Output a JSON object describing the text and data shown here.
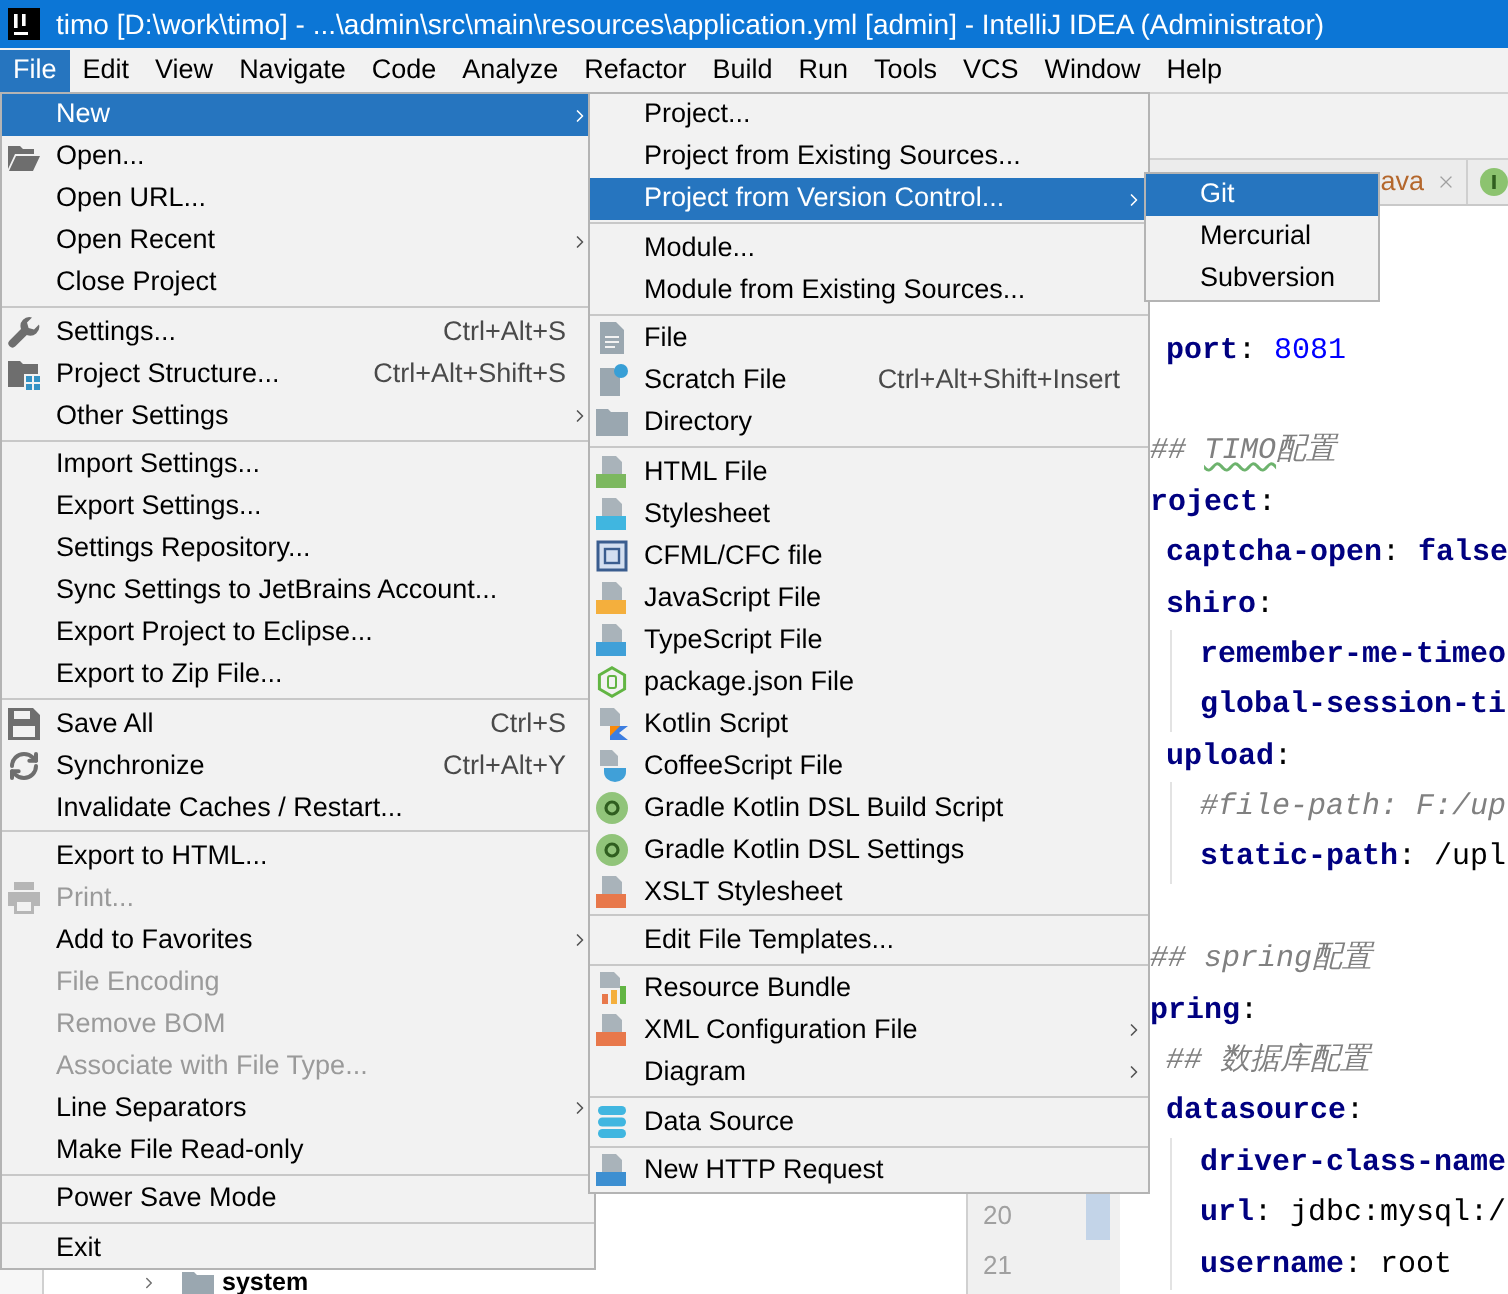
{
  "window": {
    "title": "timo [D:\\work\\timo] - ...\\admin\\src\\main\\resources\\application.yml [admin] - IntelliJ IDEA (Administrator)"
  },
  "menu_bar": [
    {
      "label": "File",
      "selected": true
    },
    {
      "label": "Edit",
      "selected": false
    },
    {
      "label": "View",
      "selected": false
    },
    {
      "label": "Navigate",
      "selected": false
    },
    {
      "label": "Code",
      "selected": false
    },
    {
      "label": "Analyze",
      "selected": false
    },
    {
      "label": "Refactor",
      "selected": false
    },
    {
      "label": "Build",
      "selected": false
    },
    {
      "label": "Run",
      "selected": false
    },
    {
      "label": "Tools",
      "selected": false
    },
    {
      "label": "VCS",
      "selected": false
    },
    {
      "label": "Window",
      "selected": false
    },
    {
      "label": "Help",
      "selected": false
    }
  ],
  "file_menu": {
    "items": [
      {
        "kind": "item",
        "label": "New",
        "selected": true,
        "disabled": false,
        "submenu": true
      },
      {
        "kind": "item",
        "label": "Open...",
        "selected": false,
        "disabled": false,
        "submenu": false
      },
      {
        "kind": "item",
        "label": "Open URL...",
        "selected": false,
        "disabled": false,
        "submenu": false
      },
      {
        "kind": "item",
        "label": "Open Recent",
        "selected": false,
        "disabled": false,
        "submenu": true
      },
      {
        "kind": "item",
        "label": "Close Project",
        "selected": false,
        "disabled": false,
        "submenu": false
      },
      {
        "kind": "separator"
      },
      {
        "kind": "item",
        "label": "Settings...",
        "shortcut": "Ctrl+Alt+S",
        "selected": false,
        "disabled": false,
        "submenu": false
      },
      {
        "kind": "item",
        "label": "Project Structure...",
        "shortcut": "Ctrl+Alt+Shift+S",
        "selected": false,
        "disabled": false,
        "submenu": false
      },
      {
        "kind": "item",
        "label": "Other Settings",
        "selected": false,
        "disabled": false,
        "submenu": true
      },
      {
        "kind": "separator"
      },
      {
        "kind": "item",
        "label": "Import Settings...",
        "selected": false,
        "disabled": false,
        "submenu": false
      },
      {
        "kind": "item",
        "label": "Export Settings...",
        "selected": false,
        "disabled": false,
        "submenu": false
      },
      {
        "kind": "item",
        "label": "Settings Repository...",
        "selected": false,
        "disabled": false,
        "submenu": false
      },
      {
        "kind": "item",
        "label": "Sync Settings to JetBrains Account...",
        "selected": false,
        "disabled": false,
        "submenu": false
      },
      {
        "kind": "item",
        "label": "Export Project to Eclipse...",
        "selected": false,
        "disabled": false,
        "submenu": false
      },
      {
        "kind": "item",
        "label": "Export to Zip File...",
        "selected": false,
        "disabled": false,
        "submenu": false
      },
      {
        "kind": "separator"
      },
      {
        "kind": "item",
        "label": "Save All",
        "shortcut": "Ctrl+S",
        "selected": false,
        "disabled": false,
        "submenu": false
      },
      {
        "kind": "item",
        "label": "Synchronize",
        "shortcut": "Ctrl+Alt+Y",
        "selected": false,
        "disabled": false,
        "submenu": false
      },
      {
        "kind": "item",
        "label": "Invalidate Caches / Restart...",
        "selected": false,
        "disabled": false,
        "submenu": false
      },
      {
        "kind": "separator"
      },
      {
        "kind": "item",
        "label": "Export to HTML...",
        "selected": false,
        "disabled": false,
        "submenu": false
      },
      {
        "kind": "item",
        "label": "Print...",
        "selected": false,
        "disabled": true,
        "submenu": false
      },
      {
        "kind": "item",
        "label": "Add to Favorites",
        "selected": false,
        "disabled": false,
        "submenu": true
      },
      {
        "kind": "item",
        "label": "File Encoding",
        "selected": false,
        "disabled": true,
        "submenu": false
      },
      {
        "kind": "item",
        "label": "Remove BOM",
        "selected": false,
        "disabled": true,
        "submenu": false
      },
      {
        "kind": "item",
        "label": "Associate with File Type...",
        "selected": false,
        "disabled": true,
        "submenu": false
      },
      {
        "kind": "item",
        "label": "Line Separators",
        "selected": false,
        "disabled": false,
        "submenu": true
      },
      {
        "kind": "item",
        "label": "Make File Read-only",
        "selected": false,
        "disabled": false,
        "submenu": false
      },
      {
        "kind": "separator"
      },
      {
        "kind": "item",
        "label": "Power Save Mode",
        "selected": false,
        "disabled": false,
        "submenu": false
      },
      {
        "kind": "separator"
      },
      {
        "kind": "item",
        "label": "Exit",
        "selected": false,
        "disabled": false,
        "submenu": false
      }
    ]
  },
  "new_submenu": {
    "items": [
      {
        "kind": "item",
        "label": "Project...",
        "selected": false,
        "submenu": false
      },
      {
        "kind": "item",
        "label": "Project from Existing Sources...",
        "selected": false,
        "submenu": false
      },
      {
        "kind": "item",
        "label": "Project from Version Control...",
        "selected": true,
        "submenu": true
      },
      {
        "kind": "separator"
      },
      {
        "kind": "item",
        "label": "Module...",
        "selected": false,
        "submenu": false
      },
      {
        "kind": "item",
        "label": "Module from Existing Sources...",
        "selected": false,
        "submenu": false
      },
      {
        "kind": "separator"
      },
      {
        "kind": "item",
        "label": "File",
        "selected": false,
        "submenu": false
      },
      {
        "kind": "item",
        "label": "Scratch File",
        "shortcut": "Ctrl+Alt+Shift+Insert",
        "selected": false,
        "submenu": false
      },
      {
        "kind": "item",
        "label": "Directory",
        "selected": false,
        "submenu": false
      },
      {
        "kind": "separator"
      },
      {
        "kind": "item",
        "label": "HTML File",
        "selected": false,
        "submenu": false
      },
      {
        "kind": "item",
        "label": "Stylesheet",
        "selected": false,
        "submenu": false
      },
      {
        "kind": "item",
        "label": "CFML/CFC file",
        "selected": false,
        "submenu": false
      },
      {
        "kind": "item",
        "label": "JavaScript File",
        "selected": false,
        "submenu": false
      },
      {
        "kind": "item",
        "label": "TypeScript File",
        "selected": false,
        "submenu": false
      },
      {
        "kind": "item",
        "label": "package.json File",
        "selected": false,
        "submenu": false
      },
      {
        "kind": "item",
        "label": "Kotlin Script",
        "selected": false,
        "submenu": false
      },
      {
        "kind": "item",
        "label": "CoffeeScript File",
        "selected": false,
        "submenu": false
      },
      {
        "kind": "item",
        "label": "Gradle Kotlin DSL Build Script",
        "selected": false,
        "submenu": false
      },
      {
        "kind": "item",
        "label": "Gradle Kotlin DSL Settings",
        "selected": false,
        "submenu": false
      },
      {
        "kind": "item",
        "label": "XSLT Stylesheet",
        "selected": false,
        "submenu": false
      },
      {
        "kind": "separator"
      },
      {
        "kind": "item",
        "label": "Edit File Templates...",
        "selected": false,
        "submenu": false
      },
      {
        "kind": "separator"
      },
      {
        "kind": "item",
        "label": "Resource Bundle",
        "selected": false,
        "submenu": false
      },
      {
        "kind": "item",
        "label": "XML Configuration File",
        "selected": false,
        "submenu": true
      },
      {
        "kind": "item",
        "label": "Diagram",
        "selected": false,
        "submenu": true
      },
      {
        "kind": "separator"
      },
      {
        "kind": "item",
        "label": "Data Source",
        "selected": false,
        "submenu": false
      },
      {
        "kind": "separator"
      },
      {
        "kind": "item",
        "label": "New HTTP Request",
        "selected": false,
        "submenu": false
      }
    ]
  },
  "vcs_submenu": {
    "items": [
      {
        "kind": "item",
        "label": "Git",
        "selected": true
      },
      {
        "kind": "item",
        "label": "Mercurial",
        "selected": false
      },
      {
        "kind": "item",
        "label": "Subversion",
        "selected": false
      }
    ]
  },
  "editor": {
    "tabs": [
      {
        "kind": "label",
        "label": "ava"
      },
      {
        "kind": "icon"
      }
    ],
    "line_numbers": [
      {
        "number": "20",
        "changed": true
      },
      {
        "number": "21",
        "changed": false
      }
    ],
    "code": [
      {
        "kind": "code",
        "children": [
          {
            "kind": "code",
            "tokens": [
              {
                "kind": "key",
                "text": "port"
              },
              {
                "kind": "plain",
                "text": ": "
              },
              {
                "kind": "number",
                "text": "8081"
              }
            ]
          }
        ]
      },
      {
        "kind": "blank"
      },
      {
        "kind": "code",
        "tokens": [
          {
            "kind": "comment",
            "text": "## "
          },
          {
            "kind": "typo",
            "text": "TIMO"
          },
          {
            "kind": "comment",
            "text": "配置"
          }
        ]
      },
      {
        "kind": "code",
        "tokens": [
          {
            "kind": "key",
            "text": "roject"
          },
          {
            "kind": "plain",
            "text": ":"
          }
        ],
        "children": [
          {
            "kind": "code",
            "tokens": [
              {
                "kind": "key",
                "text": "captcha-open"
              },
              {
                "kind": "plain",
                "text": ": "
              },
              {
                "kind": "keyword",
                "text": "false"
              }
            ]
          },
          {
            "kind": "code",
            "tokens": [
              {
                "kind": "key",
                "text": "shiro"
              },
              {
                "kind": "plain",
                "text": ":"
              }
            ],
            "children": [
              {
                "kind": "code",
                "tokens": [
                  {
                    "kind": "key",
                    "text": "remember-me-timeo"
                  }
                ]
              },
              {
                "kind": "code",
                "tokens": [
                  {
                    "kind": "key",
                    "text": "global-session-ti"
                  }
                ]
              }
            ]
          },
          {
            "kind": "code",
            "tokens": [
              {
                "kind": "key",
                "text": "upload"
              },
              {
                "kind": "plain",
                "text": ":"
              }
            ],
            "children": [
              {
                "kind": "code",
                "tokens": [
                  {
                    "kind": "comment",
                    "text": "#file-path: F:/up"
                  }
                ]
              },
              {
                "kind": "code",
                "tokens": [
                  {
                    "kind": "key",
                    "text": "static-path"
                  },
                  {
                    "kind": "plain",
                    "text": ": /upl"
                  }
                ]
              }
            ]
          }
        ]
      },
      {
        "kind": "blank"
      },
      {
        "kind": "code",
        "tokens": [
          {
            "kind": "comment",
            "text": "## spring配置"
          }
        ]
      },
      {
        "kind": "code",
        "tokens": [
          {
            "kind": "key",
            "text": "pring"
          },
          {
            "kind": "plain",
            "text": ":"
          }
        ],
        "children": [
          {
            "kind": "code",
            "tokens": [
              {
                "kind": "comment",
                "text": "## 数据库配置"
              }
            ]
          },
          {
            "kind": "code",
            "tokens": [
              {
                "kind": "key",
                "text": "datasource"
              },
              {
                "kind": "plain",
                "text": ":"
              }
            ],
            "children": [
              {
                "kind": "code",
                "tokens": [
                  {
                    "kind": "key",
                    "text": "driver-class-name"
                  }
                ]
              },
              {
                "kind": "code",
                "tokens": [
                  {
                    "kind": "key",
                    "text": "url"
                  },
                  {
                    "kind": "plain",
                    "text": ": jdbc:mysql:/"
                  }
                ]
              },
              {
                "kind": "code",
                "tokens": [
                  {
                    "kind": "key",
                    "text": "username"
                  },
                  {
                    "kind": "plain",
                    "text": ": root"
                  }
                ]
              }
            ]
          }
        ]
      }
    ]
  },
  "project_tree": {
    "items": [
      {
        "label": "system",
        "expanded": false
      }
    ]
  }
}
